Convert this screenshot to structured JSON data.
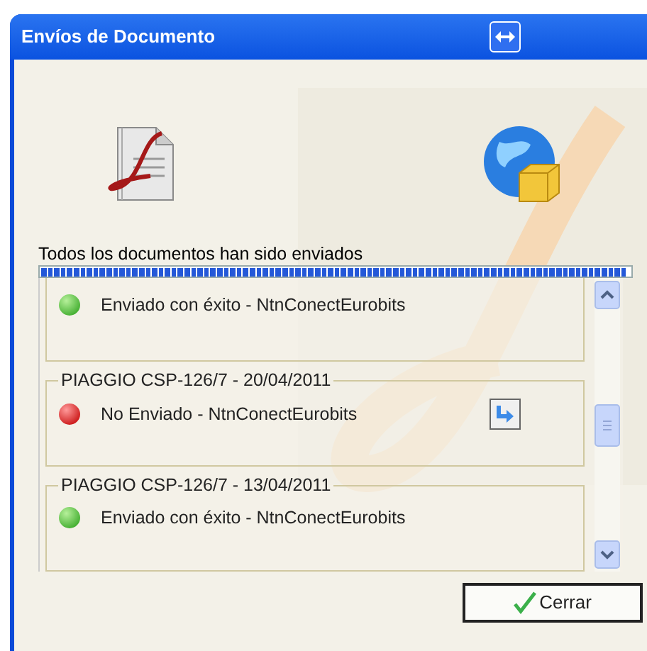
{
  "window": {
    "title": "Envíos de Documento"
  },
  "status": {
    "message": "Todos los documentos han sido enviados",
    "level": 1
  },
  "documents": [
    {
      "sent": true,
      "status": "Enviado con éxito - NtnConectEurobits"
    },
    {
      "title": "PIAGGIO  CSP-126/7 - 20/04/2011",
      "sent": false,
      "status": "No Enviado - NtnConectEurobits"
    },
    {
      "title": "PIAGGIO  CSP-126/7 - 13/04/2011",
      "sent": true,
      "status": "Enviado con éxito - NtnConectEurobits"
    }
  ],
  "buttons": {
    "close": "Cerrar"
  }
}
